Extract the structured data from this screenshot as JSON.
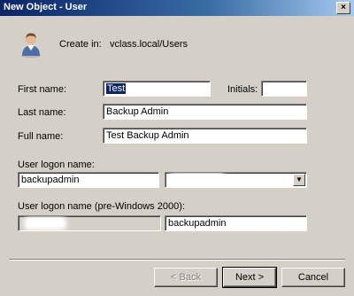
{
  "window": {
    "title": "New Object - User",
    "close_glyph": "×"
  },
  "header": {
    "create_in_label": "Create in:",
    "create_in_value": "vclass.local/Users",
    "icon": "user-icon"
  },
  "form": {
    "first_name_label": "First name:",
    "first_name_value": "Test",
    "initials_label": "Initials:",
    "initials_value": "",
    "last_name_label": "Last name:",
    "last_name_value": "Backup Admin",
    "full_name_label": "Full name:",
    "full_name_value": "Test Backup Admin",
    "logon_name_label": "User logon name:",
    "logon_name_value": "backupadmin",
    "pre2000_label": "User logon name (pre-Windows 2000):",
    "pre2000_value": "backupadmin",
    "combo_arrow": "▼"
  },
  "buttons": {
    "back": "< Back",
    "next": "Next >",
    "cancel": "Cancel"
  },
  "colors": {
    "titlebar_start": "#0a246a",
    "titlebar_end": "#a6caf0",
    "dialog_bg": "#d4d0c8"
  }
}
